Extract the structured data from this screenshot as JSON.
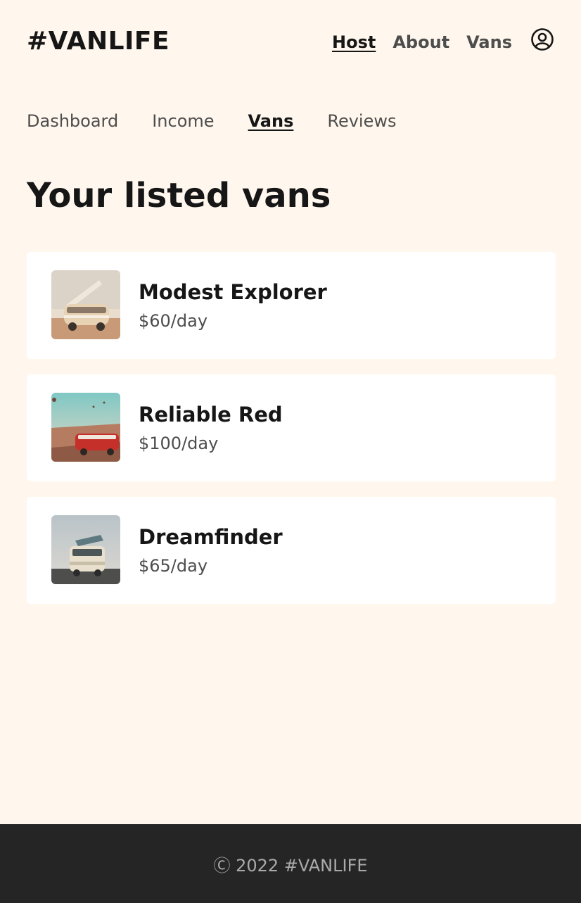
{
  "header": {
    "logo": "#VANLIFE",
    "nav": {
      "host": "Host",
      "about": "About",
      "vans": "Vans"
    },
    "profile_icon": "user-circle-icon"
  },
  "subnav": {
    "dashboard": "Dashboard",
    "income": "Income",
    "vans": "Vans",
    "reviews": "Reviews"
  },
  "main": {
    "title": "Your listed vans",
    "vans": [
      {
        "name": "Modest Explorer",
        "price": "$60/day"
      },
      {
        "name": "Reliable Red",
        "price": "$100/day"
      },
      {
        "name": "Dreamfinder",
        "price": "$65/day"
      }
    ]
  },
  "footer": {
    "copyright": "Ⓒ 2022 #VANLIFE"
  },
  "colors": {
    "background": "#FFF7ED",
    "card": "#FFFFFF",
    "footer": "#252525",
    "text_dark": "#161616",
    "text_muted": "#4D4D4D"
  }
}
